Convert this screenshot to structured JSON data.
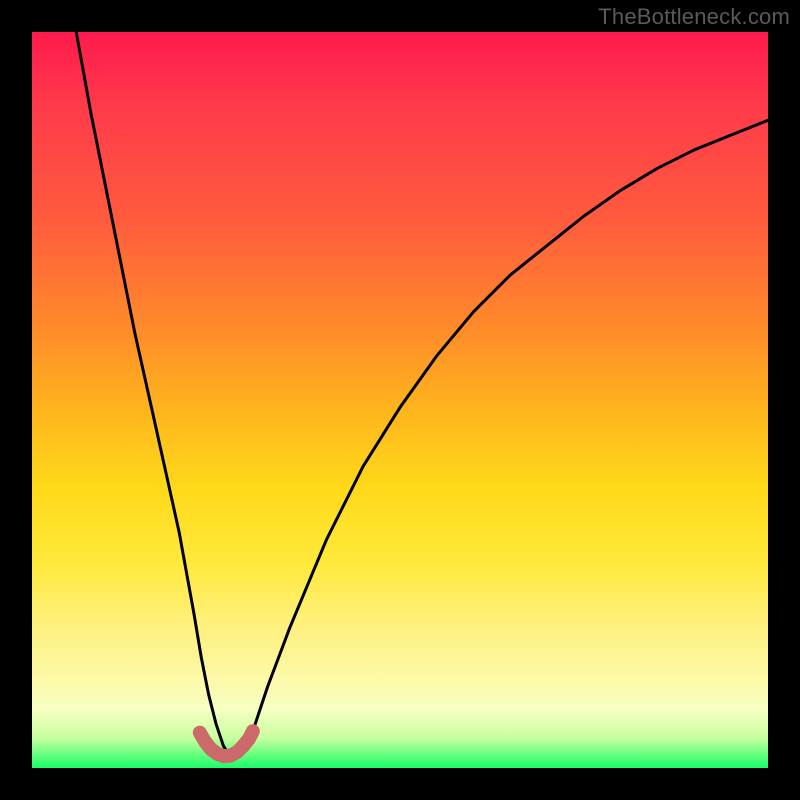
{
  "watermark": "TheBottleneck.com",
  "chart_data": {
    "type": "line",
    "title": "",
    "xlabel": "",
    "ylabel": "",
    "xlim": [
      0,
      100
    ],
    "ylim": [
      0,
      100
    ],
    "series": [
      {
        "name": "main-curve",
        "x": [
          6,
          8,
          10,
          12,
          14,
          16,
          18,
          20,
          22,
          23,
          24,
          25,
          26,
          27,
          28,
          29,
          30,
          32,
          35,
          40,
          45,
          50,
          55,
          60,
          65,
          70,
          75,
          80,
          85,
          90,
          95,
          100
        ],
        "y": [
          100,
          89,
          79,
          69,
          59,
          50,
          41,
          32,
          21,
          15,
          10,
          6,
          3,
          1.5,
          1.5,
          2.5,
          5,
          11,
          19,
          31,
          41,
          49,
          56,
          62,
          67,
          71,
          75,
          78.5,
          81.5,
          84,
          86,
          88
        ]
      },
      {
        "name": "trough-highlight",
        "x": [
          22.8,
          23.5,
          24.3,
          25.2,
          26.1,
          27.0,
          27.9,
          28.7,
          29.5,
          30.0
        ],
        "y": [
          4.8,
          3.6,
          2.6,
          1.9,
          1.6,
          1.7,
          2.2,
          3.0,
          4.0,
          5.0
        ]
      }
    ],
    "colors": {
      "main_curve": "#000000",
      "trough_highlight": "#cc6a6a",
      "gradient_top": "#ff1a4d",
      "gradient_mid": "#ffd91a",
      "gradient_bottom": "#1bff6a"
    },
    "annotations": []
  }
}
